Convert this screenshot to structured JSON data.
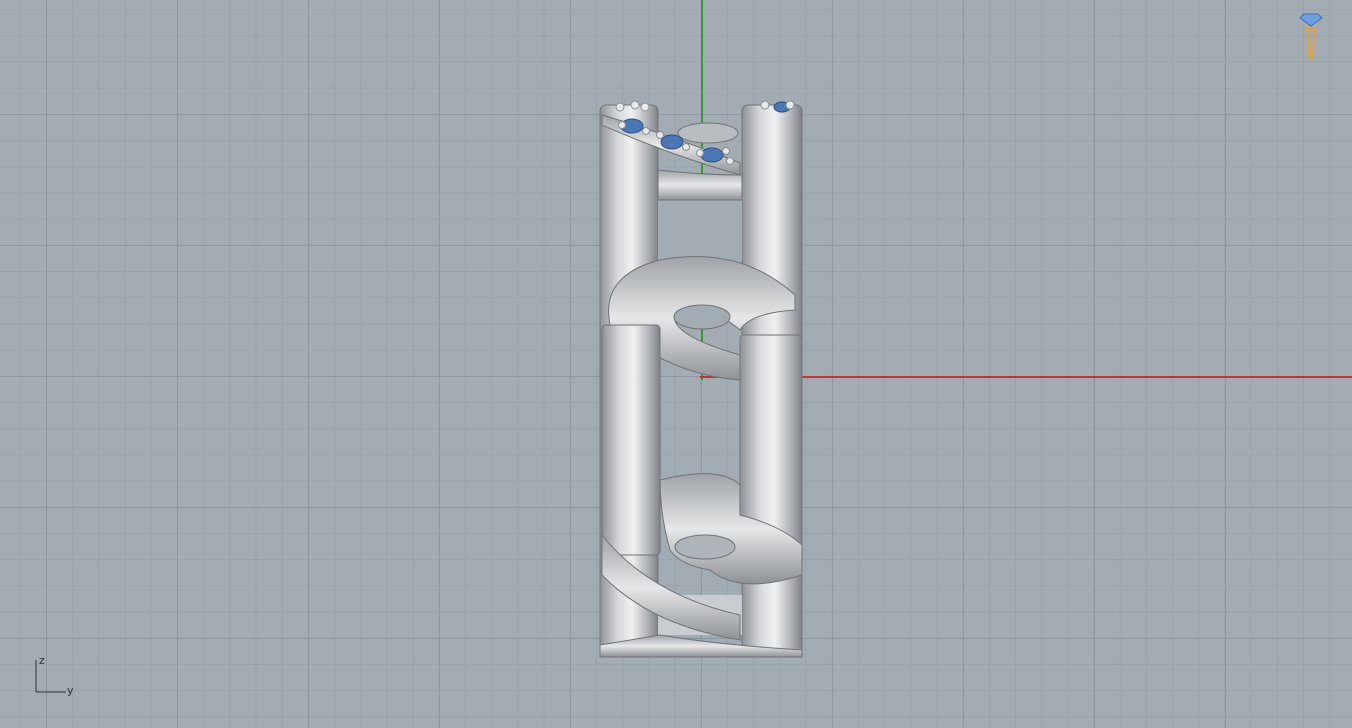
{
  "viewport": {
    "axes": {
      "x_color": "#c0362c",
      "y_color": "#2da02d"
    },
    "gizmo": {
      "z_label": "z",
      "y_label": "y"
    },
    "colors": {
      "background": "#a3abb3",
      "metal": "#c9cbcd",
      "gem": "#4a78b4"
    },
    "corner_icon": "gem-pen-icon"
  }
}
